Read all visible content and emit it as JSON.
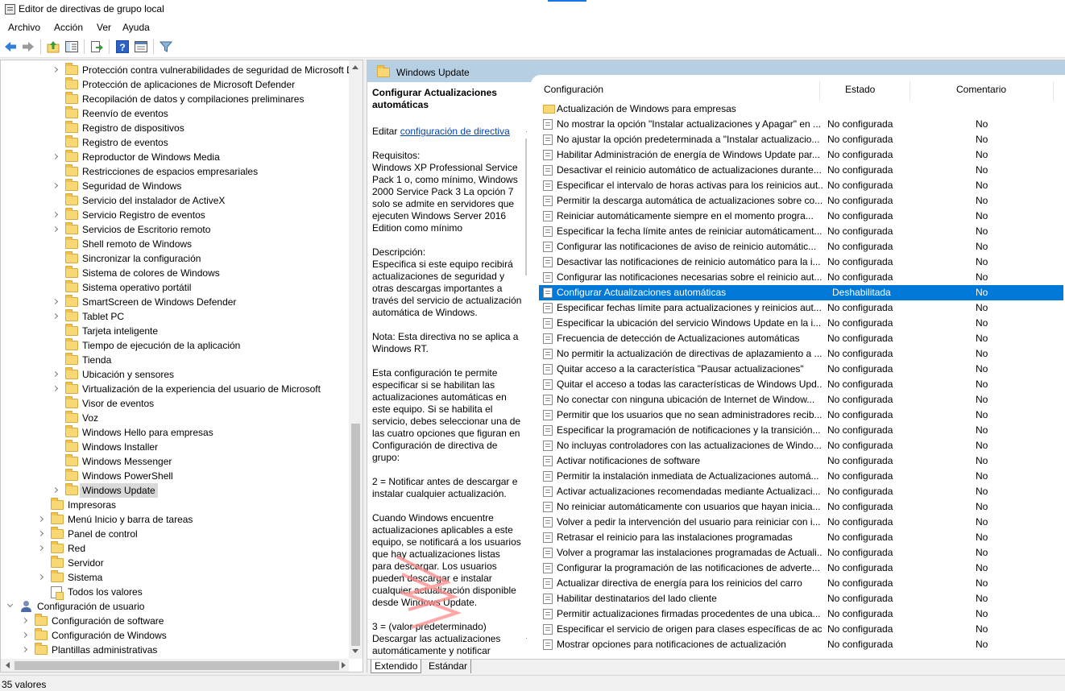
{
  "window": {
    "title": "Editor de directivas de grupo local"
  },
  "menu": [
    "Archivo",
    "Acción",
    "Ver",
    "Ayuda"
  ],
  "toolbar": [
    "back-icon",
    "forward-icon",
    "up-folder-icon",
    "show-hide-tree-icon",
    "export-list-icon",
    "help-icon",
    "properties-icon",
    "filter-icon"
  ],
  "tree": [
    {
      "label": "Protección contra vulnerabilidades de seguridad de Microsoft Defender",
      "level": 3,
      "exp": "closed"
    },
    {
      "label": "Protección de aplicaciones de Microsoft Defender",
      "level": 3,
      "exp": ""
    },
    {
      "label": "Recopilación de datos y compilaciones preliminares",
      "level": 3,
      "exp": ""
    },
    {
      "label": "Reenvío de eventos",
      "level": 3,
      "exp": ""
    },
    {
      "label": "Registro de dispositivos",
      "level": 3,
      "exp": ""
    },
    {
      "label": "Registro de eventos",
      "level": 3,
      "exp": ""
    },
    {
      "label": "Reproductor de Windows Media",
      "level": 3,
      "exp": "closed"
    },
    {
      "label": "Restricciones de espacios empresariales",
      "level": 3,
      "exp": ""
    },
    {
      "label": "Seguridad de Windows",
      "level": 3,
      "exp": "closed"
    },
    {
      "label": "Servicio del instalador de ActiveX",
      "level": 3,
      "exp": ""
    },
    {
      "label": "Servicio Registro de eventos",
      "level": 3,
      "exp": "closed"
    },
    {
      "label": "Servicios de Escritorio remoto",
      "level": 3,
      "exp": "closed"
    },
    {
      "label": "Shell remoto de Windows",
      "level": 3,
      "exp": ""
    },
    {
      "label": "Sincronizar la configuración",
      "level": 3,
      "exp": ""
    },
    {
      "label": "Sistema de colores de Windows",
      "level": 3,
      "exp": ""
    },
    {
      "label": "Sistema operativo portátil",
      "level": 3,
      "exp": ""
    },
    {
      "label": "SmartScreen de Windows Defender",
      "level": 3,
      "exp": "closed"
    },
    {
      "label": "Tablet PC",
      "level": 3,
      "exp": "closed"
    },
    {
      "label": "Tarjeta inteligente",
      "level": 3,
      "exp": ""
    },
    {
      "label": "Tiempo de ejecución de la aplicación",
      "level": 3,
      "exp": ""
    },
    {
      "label": "Tienda",
      "level": 3,
      "exp": ""
    },
    {
      "label": "Ubicación y sensores",
      "level": 3,
      "exp": "closed"
    },
    {
      "label": "Virtualización de la experiencia del usuario de Microsoft",
      "level": 3,
      "exp": "closed"
    },
    {
      "label": "Visor de eventos",
      "level": 3,
      "exp": ""
    },
    {
      "label": "Voz",
      "level": 3,
      "exp": ""
    },
    {
      "label": "Windows Hello para empresas",
      "level": 3,
      "exp": ""
    },
    {
      "label": "Windows Installer",
      "level": 3,
      "exp": ""
    },
    {
      "label": "Windows Messenger",
      "level": 3,
      "exp": ""
    },
    {
      "label": "Windows PowerShell",
      "level": 3,
      "exp": ""
    },
    {
      "label": "Windows Update",
      "level": 3,
      "exp": "closed",
      "selected": true
    },
    {
      "label": "Impresoras",
      "level": 2,
      "exp": ""
    },
    {
      "label": "Menú Inicio y barra de tareas",
      "level": 2,
      "exp": "closed"
    },
    {
      "label": "Panel de control",
      "level": 2,
      "exp": "closed"
    },
    {
      "label": "Red",
      "level": 2,
      "exp": "closed"
    },
    {
      "label": "Servidor",
      "level": 2,
      "exp": ""
    },
    {
      "label": "Sistema",
      "level": 2,
      "exp": "closed"
    },
    {
      "label": "Todos los valores",
      "level": 2,
      "exp": "",
      "icon": "all"
    },
    {
      "label": "Configuración de usuario",
      "level": 0,
      "exp": "open",
      "icon": "user"
    },
    {
      "label": "Configuración de software",
      "level": 1,
      "exp": "closed"
    },
    {
      "label": "Configuración de Windows",
      "level": 1,
      "exp": "closed"
    },
    {
      "label": "Plantillas administrativas",
      "level": 1,
      "exp": "closed"
    }
  ],
  "right": {
    "header_title": "Windows Update",
    "desc": {
      "heading": "Configurar Actualizaciones automáticas",
      "edit_prefix": "Editar ",
      "edit_link": "configuración de directiva",
      "paragraphs": [
        "Requisitos:\nWindows XP Professional Service Pack 1 o, como mínimo, Windows 2000 Service Pack 3 La opción 7 solo se admite en servidores que ejecuten Windows Server 2016 Edition como mínimo",
        "Descripción:\nEspecifica si este equipo recibirá actualizaciones de seguridad y otras descargas importantes a través del servicio de actualización automática de Windows.",
        "Nota: Esta directiva no se aplica a Windows RT.",
        "Esta configuración te permite especificar si se habilitan las actualizaciones automáticas en este equipo. Si se habilita el servicio, debes seleccionar una de las cuatro opciones que figuran en Configuración de directiva de grupo:",
        " 2 = Notificar antes de descargar e instalar cualquier actualización.",
        " Cuando Windows encuentre actualizaciones aplicables a este equipo, se notificará a los usuarios que hay actualizaciones listas para descargar. Los usuarios pueden descargar e instalar cualquier actualización disponible desde Windows Update.",
        " 3 = (valor predeterminado) Descargar las actualizaciones automáticamente y notificar"
      ]
    },
    "columns": {
      "name": "Configuración",
      "state": "Estado",
      "comment": "Comentario"
    },
    "rows": [
      {
        "name": "Actualización de Windows para empresas",
        "state": "",
        "comment": "",
        "folder": true
      },
      {
        "name": "No mostrar la opción \"Instalar actualizaciones y Apagar\" en ...",
        "state": "No configurada",
        "comment": "No"
      },
      {
        "name": "No ajustar la opción predeterminada a \"Instalar actualizacio...",
        "state": "No configurada",
        "comment": "No"
      },
      {
        "name": "Habilitar Administración de energía de Windows Update par...",
        "state": "No configurada",
        "comment": "No"
      },
      {
        "name": "Desactivar el reinicio automático de actualizaciones durante...",
        "state": "No configurada",
        "comment": "No"
      },
      {
        "name": "Especificar el intervalo de horas activas para los reinicios aut...",
        "state": "No configurada",
        "comment": "No"
      },
      {
        "name": "Permitir la descarga automática de actualizaciones sobre co...",
        "state": "No configurada",
        "comment": "No"
      },
      {
        "name": "Reiniciar automáticamente siempre en el momento progra...",
        "state": "No configurada",
        "comment": "No"
      },
      {
        "name": "Especificar la fecha límite antes de reiniciar automáticament...",
        "state": "No configurada",
        "comment": "No"
      },
      {
        "name": "Configurar las notificaciones de aviso de reinicio automátic...",
        "state": "No configurada",
        "comment": "No"
      },
      {
        "name": "Desactivar las notificaciones de reinicio automático para la i...",
        "state": "No configurada",
        "comment": "No"
      },
      {
        "name": "Configurar las notificaciones necesarias sobre el reinicio aut...",
        "state": "No configurada",
        "comment": "No"
      },
      {
        "name": "Configurar Actualizaciones automáticas",
        "state": "Deshabilitada",
        "comment": "No",
        "selected": true
      },
      {
        "name": "Especificar fechas límite para actualizaciones y reinicios aut...",
        "state": "No configurada",
        "comment": "No"
      },
      {
        "name": "Especificar la ubicación del servicio Windows Update en la i...",
        "state": "No configurada",
        "comment": "No"
      },
      {
        "name": "Frecuencia de detección de Actualizaciones automáticas",
        "state": "No configurada",
        "comment": "No"
      },
      {
        "name": "No permitir la actualización de directivas de aplazamiento a ...",
        "state": "No configurada",
        "comment": "No"
      },
      {
        "name": "Quitar acceso a la característica \"Pausar actualizaciones\"",
        "state": "No configurada",
        "comment": "No"
      },
      {
        "name": "Quitar el acceso a todas las características de Windows Upd...",
        "state": "No configurada",
        "comment": "No"
      },
      {
        "name": "No conectar con ninguna ubicación de Internet de Window...",
        "state": "No configurada",
        "comment": "No"
      },
      {
        "name": "Permitir que los usuarios que no sean administradores recib...",
        "state": "No configurada",
        "comment": "No"
      },
      {
        "name": "Especificar la programación de notificaciones y la transición...",
        "state": "No configurada",
        "comment": "No"
      },
      {
        "name": "No incluyas controladores con las actualizaciones de Windo...",
        "state": "No configurada",
        "comment": "No"
      },
      {
        "name": "Activar notificaciones de software",
        "state": "No configurada",
        "comment": "No"
      },
      {
        "name": "Permitir la instalación inmediata de Actualizaciones automá...",
        "state": "No configurada",
        "comment": "No"
      },
      {
        "name": "Activar actualizaciones recomendadas mediante Actualizaci...",
        "state": "No configurada",
        "comment": "No"
      },
      {
        "name": "No reiniciar automáticamente con usuarios que hayan inicia...",
        "state": "No configurada",
        "comment": "No"
      },
      {
        "name": "Volver a pedir la intervención del usuario para reiniciar con i...",
        "state": "No configurada",
        "comment": "No"
      },
      {
        "name": "Retrasar el reinicio para las instalaciones programadas",
        "state": "No configurada",
        "comment": "No"
      },
      {
        "name": "Volver a programar las instalaciones programadas de Actuali...",
        "state": "No configurada",
        "comment": "No"
      },
      {
        "name": "Configurar la programación de las notificaciones de adverte...",
        "state": "No configurada",
        "comment": "No"
      },
      {
        "name": "Actualizar directiva de energía para los reinicios del carro",
        "state": "No configurada",
        "comment": "No"
      },
      {
        "name": "Habilitar destinatarios del lado cliente",
        "state": "No configurada",
        "comment": "No"
      },
      {
        "name": "Permitir actualizaciones firmadas procedentes de una ubica...",
        "state": "No configurada",
        "comment": "No"
      },
      {
        "name": "Especificar el servicio de origen para clases específicas de ac...",
        "state": "No configurada",
        "comment": "No"
      },
      {
        "name": "Mostrar opciones para notificaciones de actualización",
        "state": "No configurada",
        "comment": "No"
      }
    ],
    "tabs": [
      "Extendido",
      "Estándar"
    ]
  },
  "status": "35 valores"
}
